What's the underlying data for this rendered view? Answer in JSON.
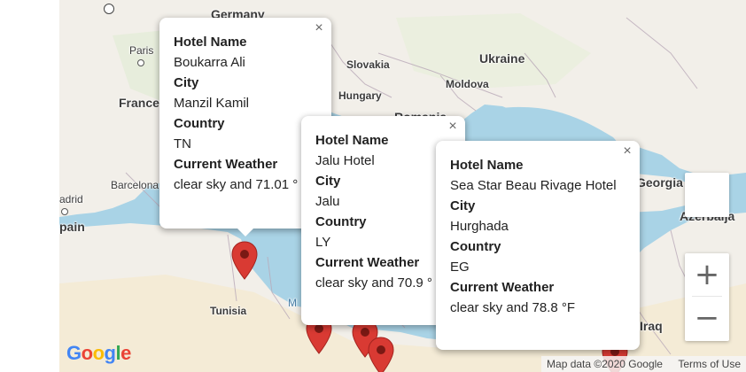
{
  "map": {
    "labels": {
      "germany": "Germany",
      "paris": "Paris",
      "france": "France",
      "slovakia": "Slovakia",
      "ukraine": "Ukraine",
      "moldova": "Moldova",
      "hungary": "Hungary",
      "romania": "Romania",
      "barcelona": "Barcelona",
      "madrid": "adrid",
      "spain": "pain",
      "tunisia": "Tunisia",
      "georgia": "Georgia",
      "azerbaijan_partial": "Azerbaija",
      "iraq": "Iraq",
      "mediterranean_partial": "M"
    },
    "markers": [
      {
        "city": "Manzil Kamil"
      },
      {
        "city": "Jalu"
      },
      {
        "city": "Hurghada"
      },
      {
        "city": "Libya coast 1"
      },
      {
        "city": "Libya coast 2"
      }
    ],
    "pin_color": "#d93a33",
    "water_color": "#a9d3e6",
    "land_color": "#f2efe9"
  },
  "popups": [
    {
      "hotel_name_label": "Hotel Name",
      "hotel_name": "Boukarra Ali",
      "city_label": "City",
      "city": "Manzil Kamil",
      "country_label": "Country",
      "country": "TN",
      "weather_label": "Current Weather",
      "weather": "clear sky and 71.01 °",
      "close": "×"
    },
    {
      "hotel_name_label": "Hotel Name",
      "hotel_name": "Jalu Hotel",
      "city_label": "City",
      "city": "Jalu",
      "country_label": "Country",
      "country": "LY",
      "weather_label": "Current Weather",
      "weather": "clear sky and 70.9 °",
      "close": "×"
    },
    {
      "hotel_name_label": "Hotel Name",
      "hotel_name": "Sea Star Beau Rivage Hotel",
      "city_label": "City",
      "city": "Hurghada",
      "country_label": "Country",
      "country": "EG",
      "weather_label": "Current Weather",
      "weather": "clear sky and 78.8 °F",
      "close": "×"
    }
  ],
  "controls": {
    "zoom_in": "+",
    "zoom_out": "−"
  },
  "footer": {
    "logo": "Google",
    "map_data": "Map data ©2020 Google",
    "terms": "Terms of Use"
  }
}
